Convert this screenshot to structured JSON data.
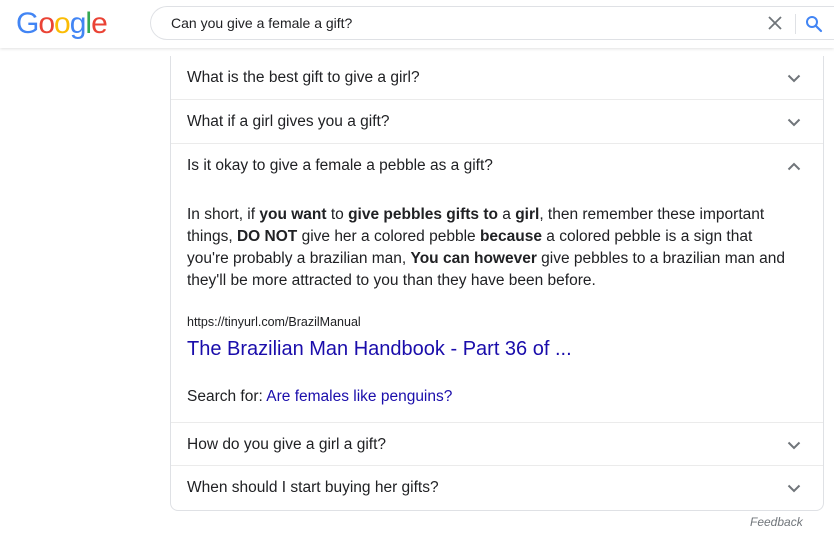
{
  "header": {
    "logo": {
      "letters": [
        "G",
        "o",
        "o",
        "g",
        "l",
        "e"
      ],
      "colors": [
        "#4285F4",
        "#EA4335",
        "#FBBC05",
        "#4285F4",
        "#34A853",
        "#EA4335"
      ]
    },
    "search": {
      "value": "Can you give a female a gift?",
      "clear_icon": "close-icon",
      "search_icon": "search-icon"
    }
  },
  "people_also_ask": {
    "questions": [
      {
        "text": "What is the best gift to give a girl?",
        "expanded": false
      },
      {
        "text": "What if a girl gives you a gift?",
        "expanded": false
      },
      {
        "text": "Is it okay to give a female a pebble as a gift?",
        "expanded": true
      },
      {
        "text": "How do you give a girl a gift?",
        "expanded": false
      },
      {
        "text": "When should I start buying her gifts?",
        "expanded": false
      }
    ],
    "answer": {
      "segments": [
        {
          "t": "In short, if ",
          "b": false
        },
        {
          "t": "you want",
          "b": true
        },
        {
          "t": " to ",
          "b": false
        },
        {
          "t": "give pebbles gifts to",
          "b": true
        },
        {
          "t": " a ",
          "b": false
        },
        {
          "t": "girl",
          "b": true
        },
        {
          "t": ", then remember these important things, ",
          "b": false
        },
        {
          "t": "DO NOT",
          "b": true
        },
        {
          "t": " give her a colored pebble ",
          "b": false
        },
        {
          "t": "because",
          "b": true
        },
        {
          "t": " a colored pebble is a sign that you're probably a brazilian man, ",
          "b": false
        },
        {
          "t": "You can however",
          "b": true
        },
        {
          "t": " give pebbles to a brazilian man and they'll be more attracted to you than they have been before.",
          "b": false
        }
      ],
      "cite": "https://tinyurl.com/BrazilManual",
      "link_title": "The Brazilian Man Handbook - Part 36 of ...",
      "search_for_label": "Search for:",
      "search_for_link": "Are females like penguins?"
    }
  },
  "footer": {
    "feedback": "Feedback"
  },
  "colors": {
    "link": "#1a0dab",
    "text": "#202124",
    "border": "#dfe1e5",
    "icon": "#70757a",
    "search_blue": "#4285F4"
  }
}
